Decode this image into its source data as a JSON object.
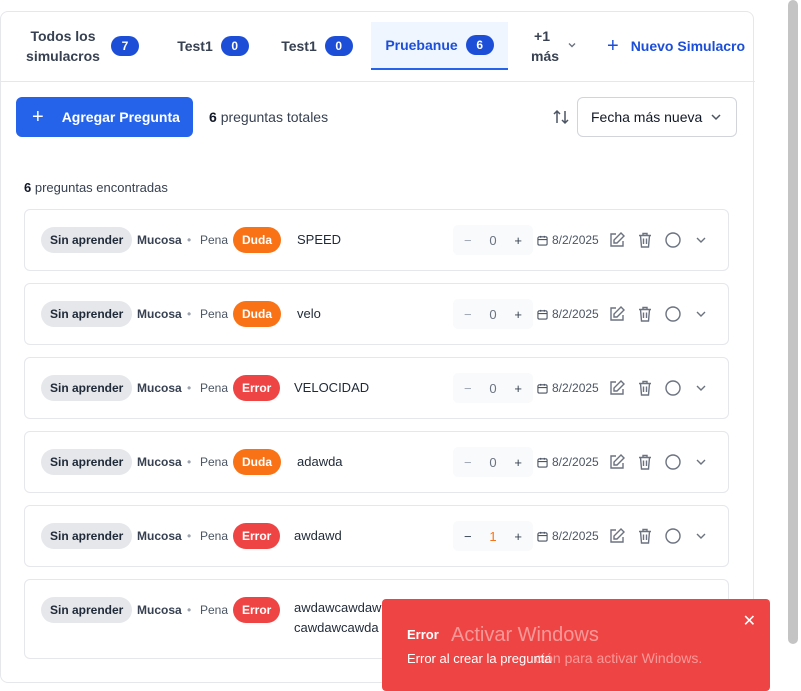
{
  "tabs": [
    {
      "label": "Todos los simulacros",
      "count": "7"
    },
    {
      "label": "Test1",
      "count": "0"
    },
    {
      "label": "Test1",
      "count": "0"
    },
    {
      "label": "Pruebanue",
      "count": "6"
    },
    {
      "label": "+1 más"
    }
  ],
  "new_simulation_label": "Nuevo Simulacro",
  "toolbar": {
    "add_question_label": "Agregar Pregunta",
    "total_count": "6",
    "total_suffix": "preguntas totales",
    "sort_value": "Fecha más nueva"
  },
  "found": {
    "count": "6",
    "suffix": "preguntas encontradas"
  },
  "questions": [
    {
      "status": "Sin aprender",
      "subject": "Mucosa",
      "topic": "Pena",
      "type": "Duda",
      "text": "SPEED",
      "count": "0",
      "date": "8/2/2025"
    },
    {
      "status": "Sin aprender",
      "subject": "Mucosa",
      "topic": "Pena",
      "type": "Duda",
      "text": "velo",
      "count": "0",
      "date": "8/2/2025"
    },
    {
      "status": "Sin aprender",
      "subject": "Mucosa",
      "topic": "Pena",
      "type": "Error",
      "text": "VELOCIDAD",
      "count": "0",
      "date": "8/2/2025"
    },
    {
      "status": "Sin aprender",
      "subject": "Mucosa",
      "topic": "Pena",
      "type": "Duda",
      "text": "adawda",
      "count": "0",
      "date": "8/2/2025"
    },
    {
      "status": "Sin aprender",
      "subject": "Mucosa",
      "topic": "Pena",
      "type": "Error",
      "text": "awdawd",
      "count": "1",
      "date": "8/2/2025"
    },
    {
      "status": "Sin aprender",
      "subject": "Mucosa",
      "topic": "Pena",
      "type": "Error",
      "text": "awdawcawdaw cawdawcawda"
    }
  ],
  "toast": {
    "title": "Error",
    "message": "Error al crear la pregunta"
  },
  "watermark": {
    "title": "Activar Windows",
    "subtitle": "ción para activar Windows."
  },
  "colors": {
    "primary": "#2563eb",
    "duda": "#f97316",
    "error": "#ef4444"
  }
}
